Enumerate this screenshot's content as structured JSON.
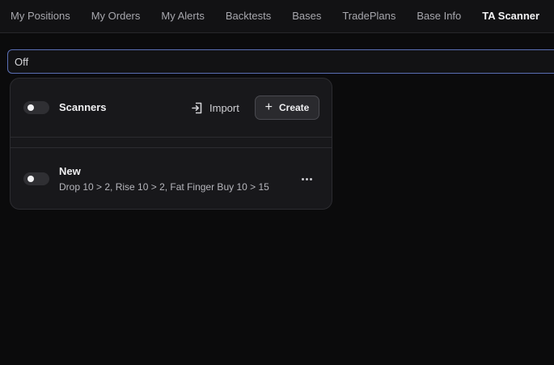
{
  "nav": {
    "tabs": [
      {
        "label": "My Positions"
      },
      {
        "label": "My Orders"
      },
      {
        "label": "My Alerts"
      },
      {
        "label": "Backtests"
      },
      {
        "label": "Bases"
      },
      {
        "label": "TradePlans"
      },
      {
        "label": "Base Info"
      },
      {
        "label": "TA Scanner",
        "active": true
      }
    ]
  },
  "filter": {
    "value": "Off"
  },
  "scanners": {
    "header": {
      "title": "Scanners",
      "toggle_on": false,
      "import_label": "Import",
      "create_label": "Create",
      "import_icon": "import-icon",
      "create_icon": "plus-icon"
    },
    "items": [
      {
        "name": "New",
        "description": "Drop 10 > 2, Rise 10 > 2, Fat Finger Buy 10 > 15",
        "toggle_on": false,
        "menu_icon": "more-horizontal-icon"
      }
    ]
  },
  "colors": {
    "background": "#0b0b0c",
    "panel": "#18181b",
    "focus_border": "#5a6fb4"
  }
}
